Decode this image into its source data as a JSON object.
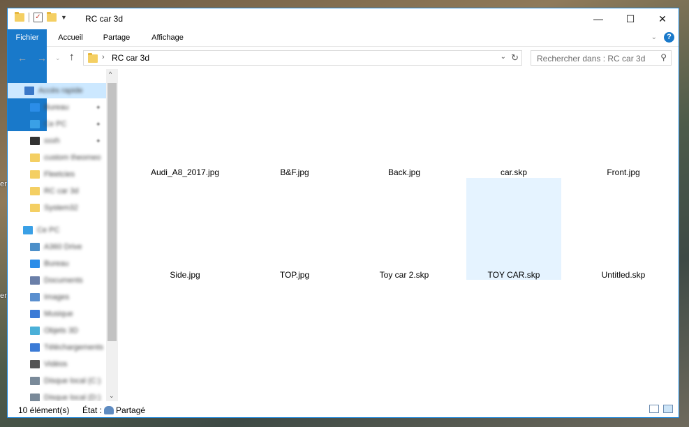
{
  "desktop": {
    "side_labels": [
      "er",
      "er"
    ]
  },
  "window": {
    "title": "RC car 3d",
    "controls": {
      "minimize": "—",
      "maximize": "☐",
      "close": "✕"
    }
  },
  "ribbon": {
    "tabs": [
      "Fichier",
      "Accueil",
      "Partage",
      "Affichage"
    ],
    "help": "?"
  },
  "address": {
    "crumb": "RC car 3d",
    "search_placeholder": "Rechercher dans : RC car 3d"
  },
  "nav_pane": {
    "items": [
      {
        "label": "Accès rapide",
        "icon": "star-pin-icon",
        "color": "#3a78c8"
      },
      {
        "label": "Bureau",
        "icon": "desktop-icon",
        "color": "#2b8de8"
      },
      {
        "label": "Ce PC",
        "icon": "computer-icon",
        "color": "#3aa0e6"
      },
      {
        "label": "xxxh",
        "icon": "app-icon",
        "color": "#333333"
      },
      {
        "label": "custom theomeo",
        "icon": "folder-icon",
        "color": "#f4cf63"
      },
      {
        "label": "Fleetcies",
        "icon": "folder-icon",
        "color": "#f4cf63"
      },
      {
        "label": "RC car 3d",
        "icon": "folder-icon",
        "color": "#f4cf63"
      },
      {
        "label": "System32",
        "icon": "folder-icon",
        "color": "#f4cf63"
      },
      {
        "label": "Ce PC",
        "icon": "computer-icon",
        "color": "#3aa0e6"
      },
      {
        "label": "A360 Drive",
        "icon": "cloud-drive-icon",
        "color": "#4c8fc9"
      },
      {
        "label": "Bureau",
        "icon": "desktop-icon",
        "color": "#2b8de8"
      },
      {
        "label": "Documents",
        "icon": "documents-icon",
        "color": "#6a7fa8"
      },
      {
        "label": "Images",
        "icon": "images-icon",
        "color": "#5a8fcf"
      },
      {
        "label": "Musique",
        "icon": "music-icon",
        "color": "#3b7bd6"
      },
      {
        "label": "Objets 3D",
        "icon": "3d-objects-icon",
        "color": "#4bb0d8"
      },
      {
        "label": "Téléchargements",
        "icon": "downloads-icon",
        "color": "#3b7bd6"
      },
      {
        "label": "Vidéos",
        "icon": "videos-icon",
        "color": "#555555"
      },
      {
        "label": "Disque local (C:)",
        "icon": "drive-icon",
        "color": "#7a8a99"
      },
      {
        "label": "Disque local (D:)",
        "icon": "drive-icon",
        "color": "#7a8a99"
      }
    ],
    "clear_suffixes": {
      "tel": "nt",
      "c": "C:)",
      "d": "D:)"
    }
  },
  "files": [
    {
      "name": "Audi_A8_2017.jpg",
      "selected": false
    },
    {
      "name": "B&F.jpg",
      "selected": false
    },
    {
      "name": "Back.jpg",
      "selected": false
    },
    {
      "name": "car.skp",
      "selected": false
    },
    {
      "name": "Front.jpg",
      "selected": false
    },
    {
      "name": "Side.jpg",
      "selected": false
    },
    {
      "name": "TOP.jpg",
      "selected": false
    },
    {
      "name": "Toy car 2.skp",
      "selected": false
    },
    {
      "name": "TOY CAR.skp",
      "selected": true
    },
    {
      "name": "Untitled.skp",
      "selected": false
    }
  ],
  "status": {
    "count": "10 élément(s)",
    "state_label": "État :",
    "state_value": "Partagé"
  }
}
